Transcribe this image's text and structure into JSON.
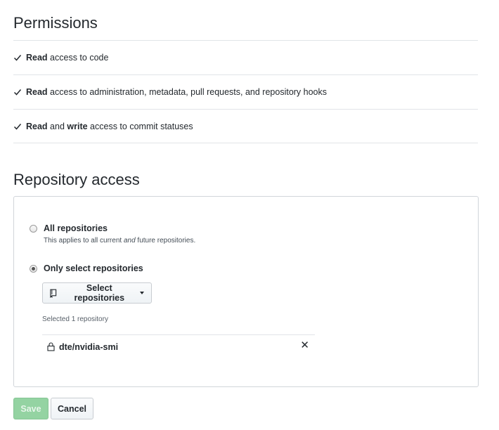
{
  "permissions": {
    "heading": "Permissions",
    "items": [
      {
        "bold": "Read",
        "text": " access to code"
      },
      {
        "bold": "Read",
        "text": " access to administration, metadata, pull requests, and repository hooks"
      },
      {
        "bold": "Read",
        "mid": " and ",
        "bold2": "write",
        "text": " access to commit statuses"
      }
    ]
  },
  "repository_access": {
    "heading": "Repository access",
    "options": [
      {
        "label": "All repositories",
        "note_pre": "This applies to all current ",
        "note_em": "and",
        "note_post": " future repositories.",
        "checked": false
      },
      {
        "label": "Only select repositories",
        "checked": true
      }
    ],
    "select_button": "Select repositories",
    "selected_count": "Selected 1 repository",
    "repos": [
      {
        "name": "dte/nvidia-smi",
        "remove": "✕"
      }
    ]
  },
  "actions": {
    "save": "Save",
    "cancel": "Cancel"
  },
  "colors": {
    "save_bg": "#94d3a2",
    "border": "#e1e4e8"
  }
}
